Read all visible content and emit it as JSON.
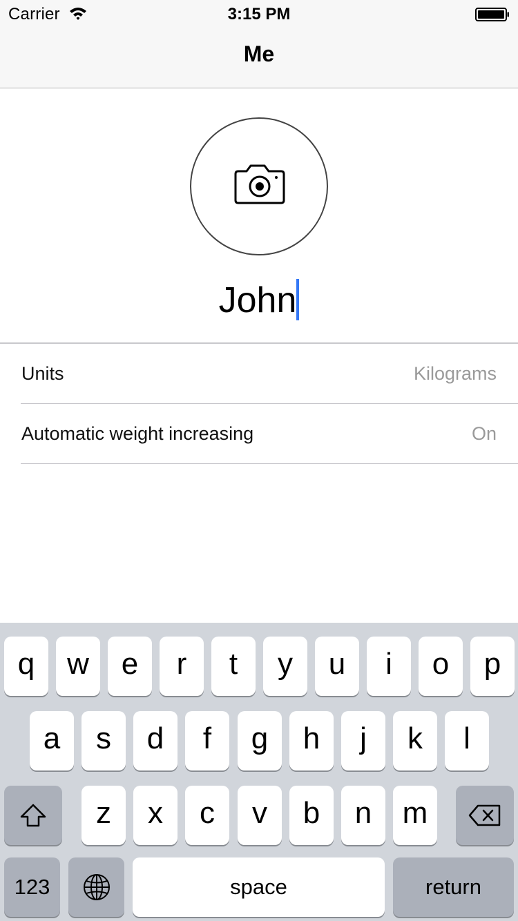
{
  "status_bar": {
    "carrier": "Carrier",
    "time": "3:15 PM",
    "wifi_icon": "wifi-icon",
    "battery_icon": "battery-icon"
  },
  "nav": {
    "title": "Me"
  },
  "profile": {
    "avatar_icon": "camera-icon",
    "name_value": "John"
  },
  "settings": {
    "rows": [
      {
        "label": "Units",
        "value": "Kilograms"
      },
      {
        "label": "Automatic weight increasing",
        "value": "On"
      }
    ]
  },
  "keyboard": {
    "row1": [
      "q",
      "w",
      "e",
      "r",
      "t",
      "y",
      "u",
      "i",
      "o",
      "p"
    ],
    "row2": [
      "a",
      "s",
      "d",
      "f",
      "g",
      "h",
      "j",
      "k",
      "l"
    ],
    "row3": [
      "z",
      "x",
      "c",
      "v",
      "b",
      "n",
      "m"
    ],
    "shift_icon": "shift-icon",
    "delete_icon": "backspace-icon",
    "globe_icon": "globe-icon",
    "numbers_label": "123",
    "space_label": "space",
    "return_label": "return"
  },
  "colors": {
    "cursor": "#3478f6",
    "secondary_text": "#9a9a9a",
    "keyboard_background": "#d1d5db",
    "special_key": "#abb0ba"
  }
}
